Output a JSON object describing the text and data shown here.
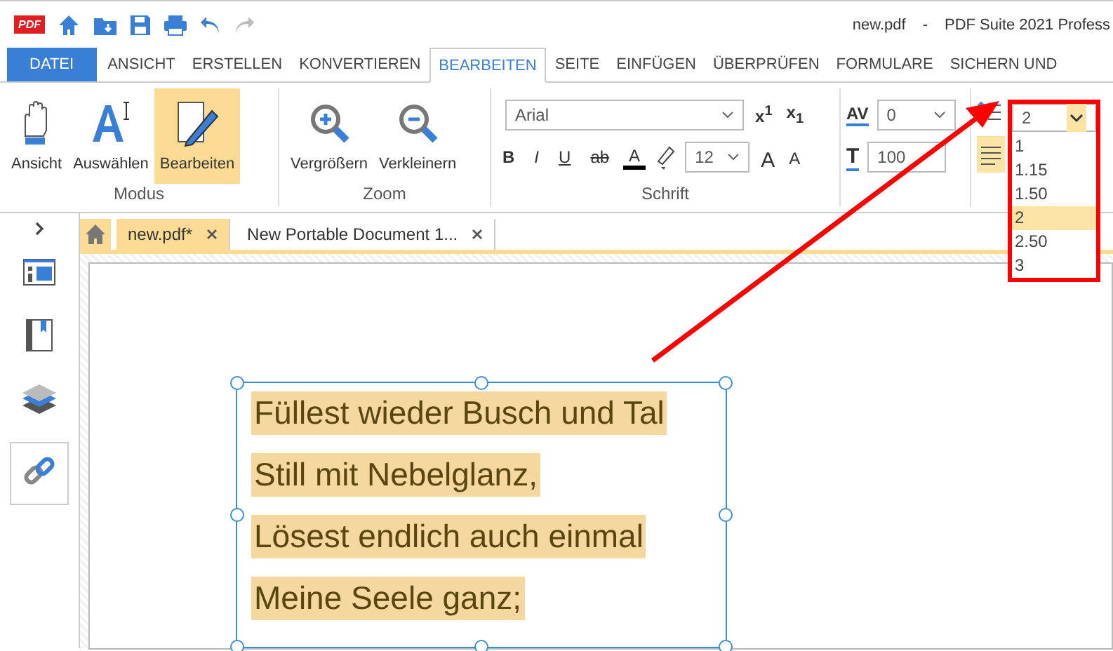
{
  "title_bar": {
    "file": "new.pdf",
    "separator": "-",
    "app": "PDF Suite 2021 Profess",
    "logo": "PDF"
  },
  "menu_tabs": [
    {
      "label": "DATEI",
      "kind": "file",
      "selected": false
    },
    {
      "label": "ANSICHT",
      "kind": "tab",
      "selected": false
    },
    {
      "label": "ERSTELLEN",
      "kind": "tab",
      "selected": false
    },
    {
      "label": "KONVERTIEREN",
      "kind": "tab",
      "selected": false
    },
    {
      "label": "BEARBEITEN",
      "kind": "tab",
      "selected": true
    },
    {
      "label": "SEITE",
      "kind": "tab",
      "selected": false
    },
    {
      "label": "EINFÜGEN",
      "kind": "tab",
      "selected": false
    },
    {
      "label": "ÜBERPRÜFEN",
      "kind": "tab",
      "selected": false
    },
    {
      "label": "FORMULARE",
      "kind": "tab",
      "selected": false
    },
    {
      "label": "SICHERN UND",
      "kind": "tab",
      "selected": false
    }
  ],
  "modus": {
    "label": "Modus",
    "buttons": [
      {
        "label": "Ansicht",
        "kind": "hand",
        "selected": false
      },
      {
        "label": "Auswählen",
        "kind": "select",
        "selected": false
      },
      {
        "label": "Bearbeiten",
        "kind": "edit",
        "selected": true
      }
    ]
  },
  "zoom": {
    "label": "Zoom",
    "buttons": [
      {
        "label": "Vergrößern",
        "kind": "in"
      },
      {
        "label": "Verkleinern",
        "kind": "out"
      }
    ]
  },
  "schrift": {
    "label": "Schrift",
    "font": "Arial",
    "size": "12",
    "script_buttons": [
      "x$^{1}$",
      "x$_{1}$"
    ],
    "format_buttons": [
      {
        "label": "B",
        "kind": "bold"
      },
      {
        "label": "I",
        "kind": "italic"
      },
      {
        "label": "U",
        "kind": "underline"
      },
      {
        "label": "ab",
        "kind": "strike"
      },
      {
        "label": "A",
        "kind": "color"
      }
    ],
    "grow_buttons": [
      "A",
      "A"
    ]
  },
  "spacing": {
    "char_label": "AV",
    "char_value": "0",
    "scale_label": "T",
    "scale_value": "100"
  },
  "line_spacing": {
    "value": "2",
    "align_selected": true,
    "options": [
      {
        "label": "1",
        "selected": false
      },
      {
        "label": "1.15",
        "selected": false
      },
      {
        "label": "1.50",
        "selected": false
      },
      {
        "label": "2",
        "selected": true
      },
      {
        "label": "2.50",
        "selected": false
      },
      {
        "label": "3",
        "selected": false
      }
    ]
  },
  "doc_tabs": [
    {
      "label": "new.pdf*",
      "selected": true
    },
    {
      "label": "New Portable Document 1...",
      "selected": false
    }
  ],
  "sidebar": [
    {
      "kind": "panel",
      "selected": false
    },
    {
      "kind": "bookmark",
      "selected": false
    },
    {
      "kind": "layers",
      "selected": false
    },
    {
      "kind": "link",
      "selected": true
    }
  ],
  "text_lines": [
    "Füllest wieder Busch und Tal",
    "Still mit Nebelglanz,",
    "Lösest endlich auch einmal",
    "Meine Seele ganz;"
  ]
}
